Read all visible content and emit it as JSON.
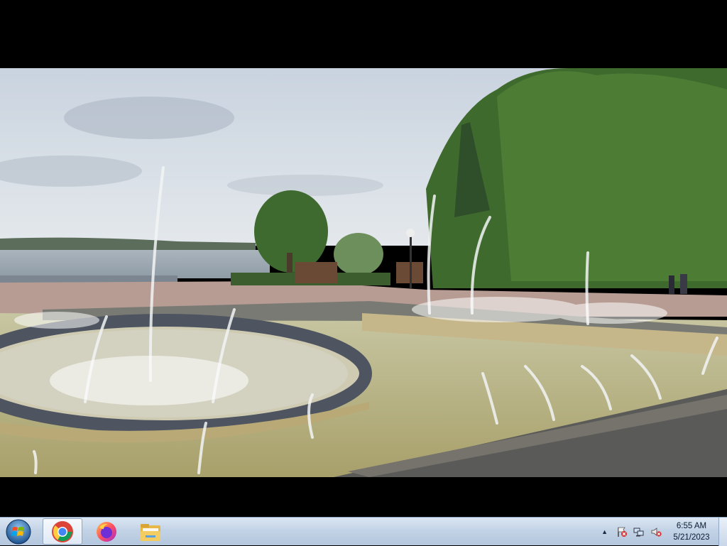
{
  "photo": {
    "alt_subject": "fountain-embankment-scene"
  },
  "taskbar": {
    "start_icon": "windows-start-orb-icon",
    "pinned": [
      {
        "name": "chrome",
        "icon": "chrome-icon",
        "active": true
      },
      {
        "name": "firefox",
        "icon": "firefox-icon",
        "active": false
      },
      {
        "name": "file-explorer",
        "icon": "folder-icon",
        "active": false
      }
    ],
    "tray": {
      "caret": "▲",
      "icons": [
        "action-center-flag-icon",
        "network-icon",
        "volume-muted-icon"
      ],
      "time": "6:55 AM",
      "date": "5/21/2023"
    }
  },
  "colors": {
    "taskbar_top": "#dbe6f3",
    "taskbar_bottom": "#b4c7de",
    "letterbox": "#000000"
  }
}
